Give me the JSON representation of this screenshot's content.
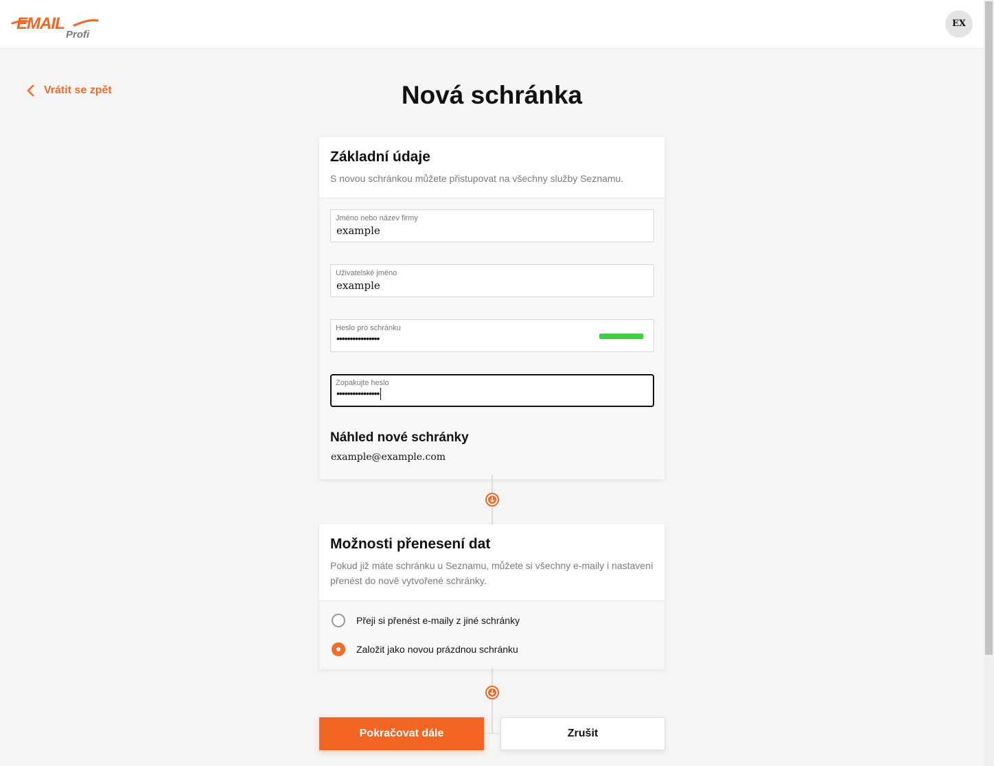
{
  "header": {
    "logo_text": "EMAIL",
    "logo_subtext": "Profi",
    "avatar_initials": "EX"
  },
  "back_link": {
    "label": "Vrátit se zpět"
  },
  "page_title": "Nová schránka",
  "basic_section": {
    "title": "Základní údaje",
    "description": "S novou schránkou můžete přistupovat na všechny služby Seznamu.",
    "fields": {
      "name": {
        "label": "Jméno nebo název firmy",
        "value": "example"
      },
      "username": {
        "label": "Uživatelské jméno",
        "value": "example"
      },
      "password": {
        "label": "Heslo pro schránku",
        "value": "••••••••••••••••",
        "strength_color": "#3ecf3e"
      },
      "password_repeat": {
        "label": "Zopakujte heslo",
        "value": "••••••••••••••••"
      }
    },
    "preview": {
      "title": "Náhled nové schránky",
      "email": "example@example.com"
    }
  },
  "transfer_section": {
    "title": "Možnosti přenesení dat",
    "description": "Pokud již máte schránku u Seznamu, můžete si všechny e-maily i nastavení přenést do nově vytvořené schránky.",
    "options": [
      {
        "label": "Přeji si přenést e-maily z jiné schránky",
        "checked": false
      },
      {
        "label": "Založit jako novou prázdnou schránku",
        "checked": true
      }
    ]
  },
  "actions": {
    "continue_label": "Pokračovat dále",
    "cancel_label": "Zrušit"
  },
  "colors": {
    "accent": "#f26522",
    "link": "#f06c2a"
  },
  "icons": {
    "back": "chevron-left-icon",
    "step": "arrow-down-circle-icon"
  }
}
